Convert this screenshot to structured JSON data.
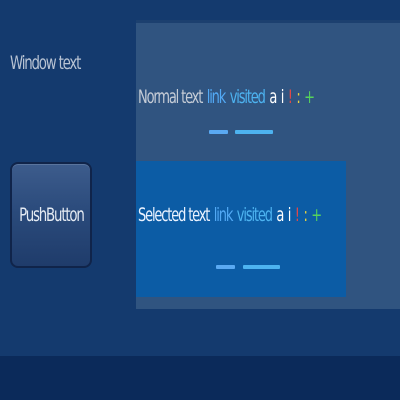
{
  "window_text": "Window text",
  "push_button_label": "PushButton",
  "normal_row": {
    "text": "Normal text",
    "link": "link",
    "visited": "visited",
    "a": "a",
    "i": "i",
    "bang": "!",
    "colon": ":",
    "plus": "+"
  },
  "selected_row": {
    "text": "Selected text",
    "link": "link",
    "visited": "visited",
    "a": "a",
    "i": "i",
    "bang": "!",
    "colon": ":",
    "plus": "+"
  },
  "colors": {
    "window_bg": "#143a6e",
    "view_bg": "#305480",
    "selection_bg": "#0c5ca5",
    "link": "#52a9f5",
    "visited": "#4db3f0",
    "error": "#e14848",
    "warning": "#e9d33e",
    "positive": "#55d35b"
  }
}
